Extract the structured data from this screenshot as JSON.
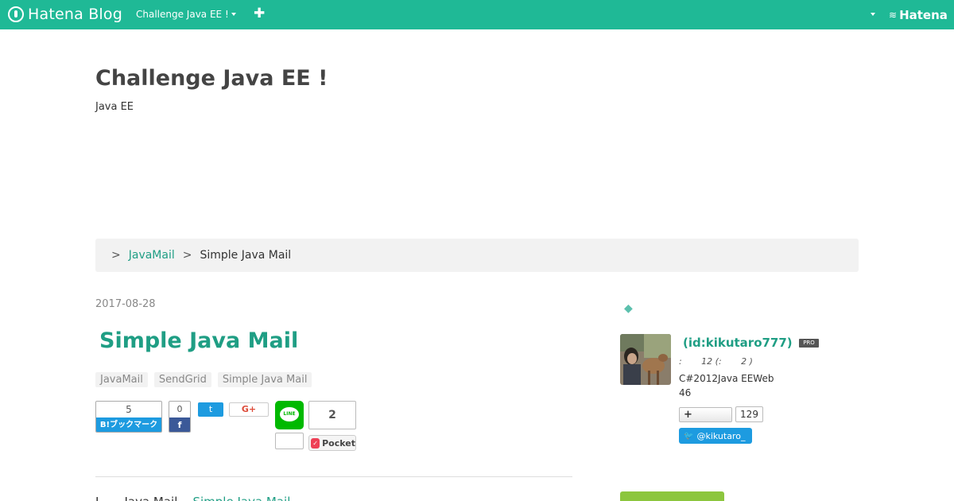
{
  "topbar": {
    "logo_text": "Hatena Blog",
    "blog_menu_label": "Challenge Java EE !",
    "add_icon": "plus-icon",
    "hatena_label": "Hatena"
  },
  "blog": {
    "title": "Challenge Java EE !",
    "description": "Java EE"
  },
  "breadcrumb": {
    "separator": ">",
    "category": "JavaMail",
    "current": "Simple Java Mail"
  },
  "entry": {
    "date": "2017-08-28",
    "title": "Simple Java Mail",
    "tags": [
      "JavaMail",
      "SendGrid",
      "Simple Java Mail"
    ],
    "body_start": "I ___ Java Mail...",
    "body_link": "Simple Java Mail"
  },
  "share": {
    "hatena_count": "5",
    "hatena_label": "B!ブックマーク",
    "facebook_count": "0",
    "facebook_label": "f",
    "twitter_label": "t",
    "gplus_label": "G+",
    "line_label": "LINE",
    "line_count": "",
    "pocket_count": "2",
    "pocket_label": "Pocket"
  },
  "sidebar": {
    "heading": "◆",
    "profile_name": "(id:kikutaro777)",
    "pro_badge": "PRO",
    "stats": ":       12 (:       2 )",
    "desc_line1": "C#2012Java EEWeb",
    "desc_line2": "46",
    "follow_label": "+",
    "follow_count": "129",
    "twitter_handle": "@kikutaro_"
  },
  "colors": {
    "brand": "#1fb996",
    "link": "#1f9e84",
    "hatena_blue": "#1d9be0",
    "facebook": "#3b5998",
    "line_green": "#00b900",
    "pocket_red": "#ee4056"
  }
}
